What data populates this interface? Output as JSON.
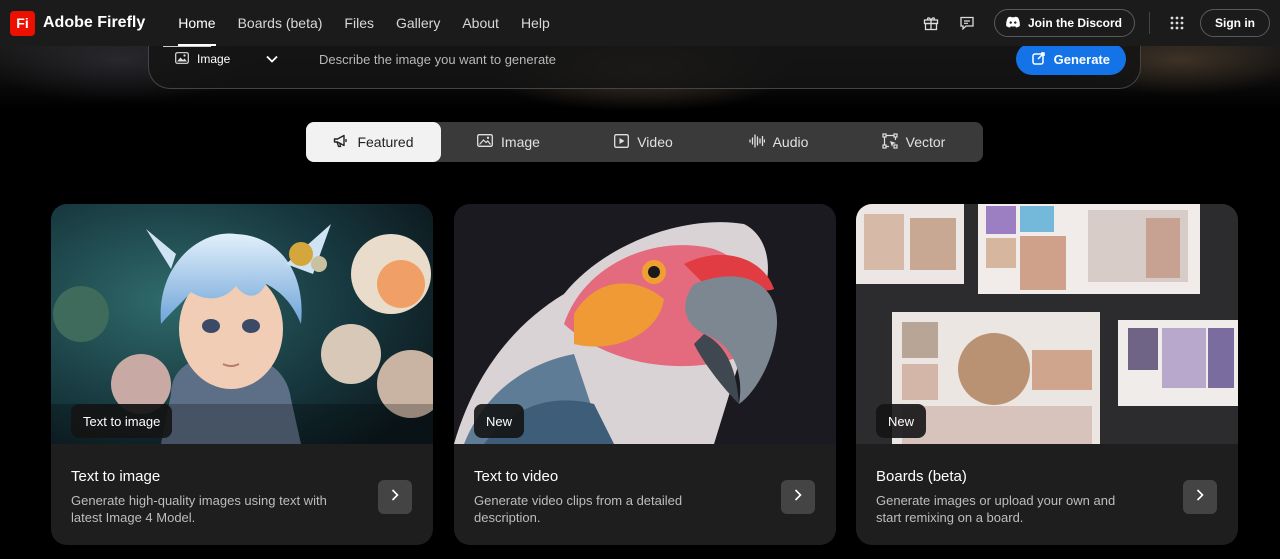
{
  "navbar": {
    "brand_logo": "Fi",
    "brand_name": "Adobe Firefly",
    "links": [
      "Home",
      "Boards (beta)",
      "Files",
      "Gallery",
      "About",
      "Help"
    ],
    "active_link": "Home",
    "discord_label": "Join the Discord",
    "signin_label": "Sign in"
  },
  "prompt": {
    "type_label": "Image",
    "placeholder": "Describe the image you want to generate",
    "generate_label": "Generate"
  },
  "tabs": [
    {
      "label": "Featured",
      "icon": "megaphone-icon"
    },
    {
      "label": "Image",
      "icon": "image-icon"
    },
    {
      "label": "Video",
      "icon": "video-icon"
    },
    {
      "label": "Audio",
      "icon": "audio-wave-icon"
    },
    {
      "label": "Vector",
      "icon": "vector-icon"
    }
  ],
  "active_tab": "Featured",
  "cards": [
    {
      "badge": "Text to image",
      "title": "Text to image",
      "description": "Generate high-quality images using text with latest Image 4 Model."
    },
    {
      "badge": "New",
      "title": "Text to video",
      "description": "Generate video clips from a detailed description."
    },
    {
      "badge": "New",
      "title": "Boards (beta)",
      "description": "Generate images or upload your own and start remixing on a board."
    }
  ],
  "colors": {
    "brand_red": "#eb1000",
    "generate_blue": "#1473e6",
    "navbar_bg": "#1b1b1b",
    "card_bg": "#1e1e1e"
  }
}
